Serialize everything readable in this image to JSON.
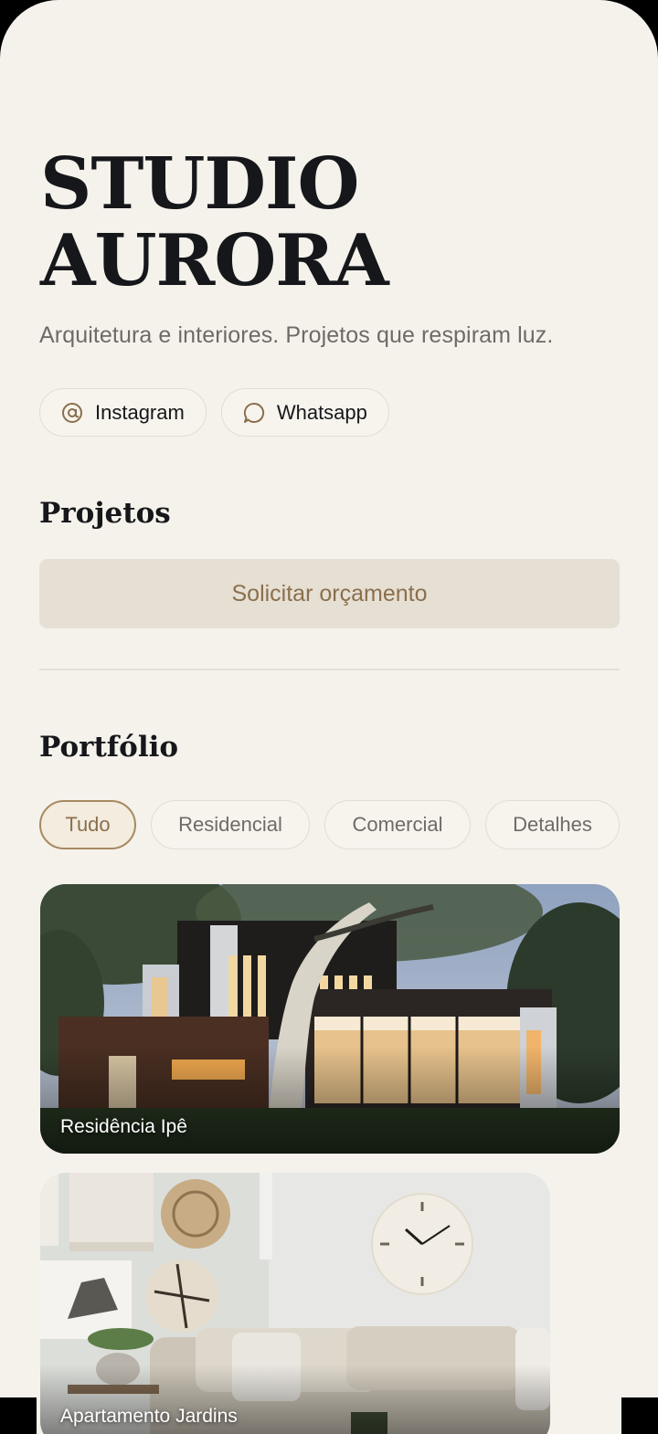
{
  "brand": {
    "line1": "STUDIO",
    "line2": "AURORA"
  },
  "tagline": "Arquitetura e interiores. Projetos que respiram luz.",
  "social": [
    {
      "label": "Instagram",
      "icon": "at-icon"
    },
    {
      "label": "Whatsapp",
      "icon": "chat-bubble-icon"
    }
  ],
  "projects": {
    "title": "Projetos",
    "cta_label": "Solicitar orçamento"
  },
  "portfolio": {
    "title": "Portfólio",
    "filters": [
      "Tudo",
      "Residencial",
      "Comercial",
      "Detalhes"
    ],
    "active_filter": "Tudo",
    "cards": [
      {
        "title": "Residência Ipê"
      },
      {
        "title": "Apartamento Jardins"
      }
    ]
  },
  "colors": {
    "background": "#f5f2ec",
    "accent": "#8a6f4d",
    "cta_background": "#e6dfd3"
  }
}
